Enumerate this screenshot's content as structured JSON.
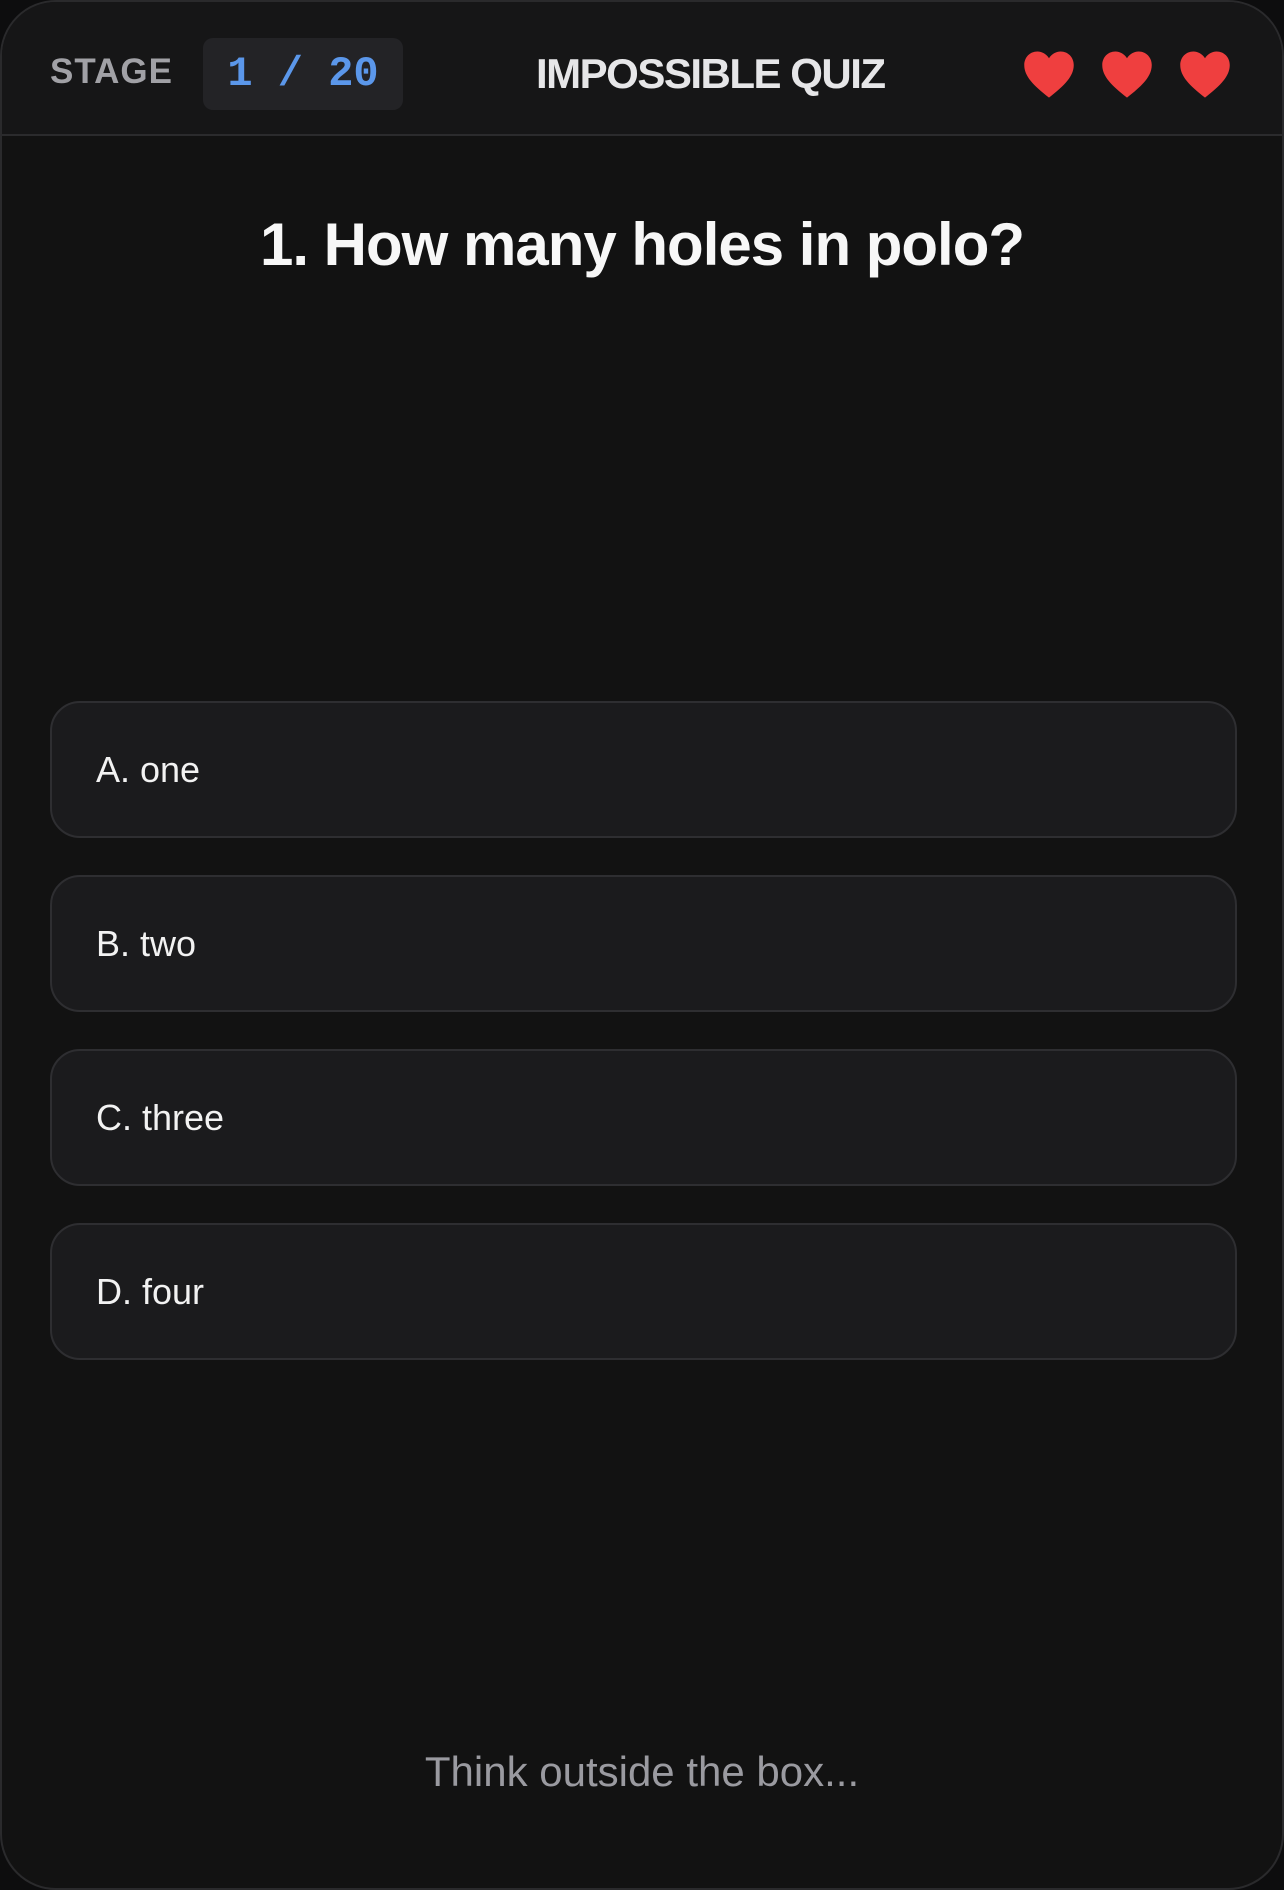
{
  "header": {
    "stage_label": "STAGE",
    "stage_counter": "1 / 20",
    "title": "IMPOSSIBLE QUIZ",
    "lives": 3,
    "heart_color": "#ef3f3f",
    "counter_color": "#5b97ea"
  },
  "question": {
    "text": "1. How many holes in polo?"
  },
  "answers": [
    {
      "label": "A. one"
    },
    {
      "label": "B. two"
    },
    {
      "label": "C. three"
    },
    {
      "label": "D. four"
    }
  ],
  "hint": "Think outside the box..."
}
